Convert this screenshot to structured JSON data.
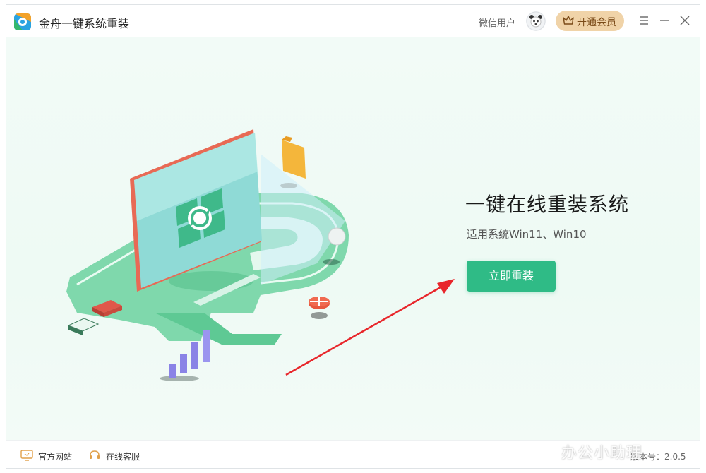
{
  "app": {
    "title": "金舟一键系统重装",
    "user_label": "微信用户",
    "vip_label": "开通会员"
  },
  "main": {
    "title": "一键在线重装系统",
    "subtitle": "适用系统Win11、Win10",
    "reinstall_label": "立即重装"
  },
  "footer": {
    "website_label": "官方网站",
    "support_label": "在线客服",
    "version_label": "版本号：2.0.5"
  },
  "watermark": "办公小助理",
  "colors": {
    "accent": "#2fbb86",
    "vip_bg": "#f0d3a8",
    "arrow": "#e8262b",
    "background": "#eefaf4"
  },
  "icons": [
    "app-logo-icon",
    "avatar-icon",
    "crown-icon",
    "menu-icon",
    "minimize-icon",
    "close-icon",
    "monitor-icon",
    "headset-icon"
  ]
}
